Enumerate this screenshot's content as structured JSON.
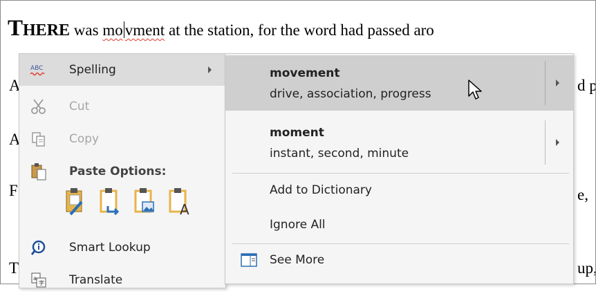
{
  "document": {
    "line1_dropcap": "T",
    "line1_smallcaps": "HERE",
    "line1_was": " was ",
    "line1_misspelled_a": "mo",
    "line1_misspelled_b": "vment",
    "line1_rest": " at the station, for the word had passed aro",
    "line2_start": "A",
    "line2_end": "d p",
    "line3_start": "A",
    "line4_start": "F",
    "line4_end": "e,",
    "line5_start": "T",
    "line5_end": "up,"
  },
  "context_menu": {
    "spelling": "Spelling",
    "cut": "Cut",
    "copy": "Copy",
    "paste_options": "Paste Options:",
    "smart_lookup": "Smart Lookup",
    "translate": "Translate"
  },
  "spelling_submenu": {
    "suggestions": [
      {
        "word": "movement",
        "synonyms": "drive, association, progress"
      },
      {
        "word": "moment",
        "synonyms": "instant, second, minute"
      }
    ],
    "add_to_dictionary": "Add to Dictionary",
    "ignore_all": "Ignore All",
    "see_more": "See More"
  },
  "colors": {
    "misspelling_underline": "#e23a2e",
    "highlight": "#cfcfcf",
    "menu_bg": "#f5f5f5"
  }
}
